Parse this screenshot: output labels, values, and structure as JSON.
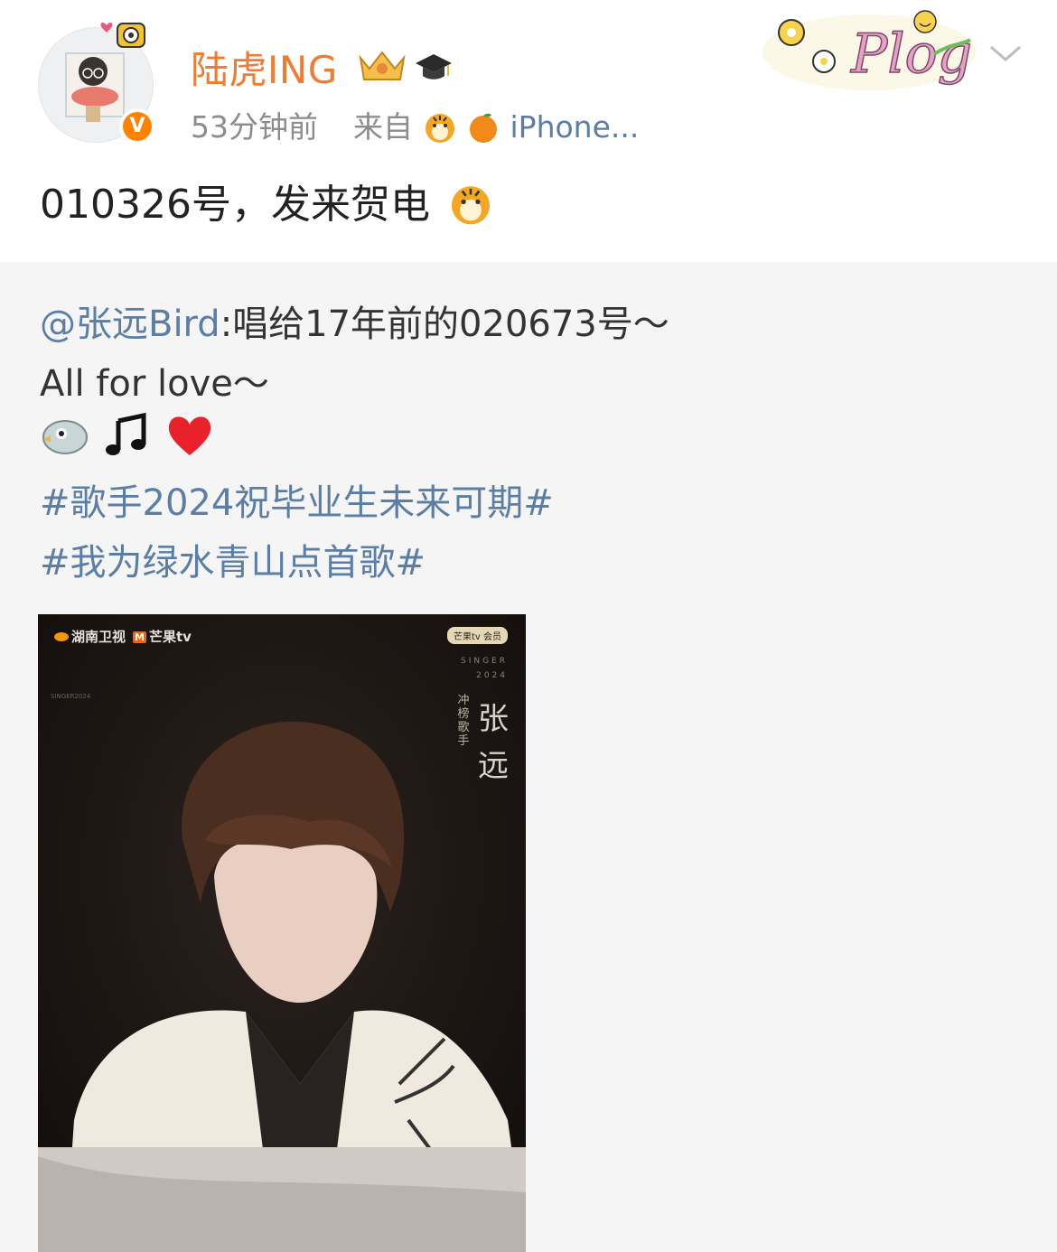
{
  "post": {
    "author": {
      "name": "陆虎ING",
      "badges": [
        "crown-badge",
        "graduation-cap-icon"
      ],
      "verified": true
    },
    "time": "53分钟前",
    "source_prefix": "来自",
    "source": "iPhone...",
    "text": "010326号，发来贺电",
    "header_sticker": "Plog"
  },
  "repost": {
    "mention": "@张远Bird",
    "text_after_mention": ":唱给17年前的020673号～",
    "line2": "All for love～",
    "emojis": [
      "bird-icon",
      "music-note-icon",
      "heart-icon"
    ],
    "topics": [
      "#歌手2024祝毕业生未来可期#",
      "#我为绿水青山点首歌#"
    ],
    "image": {
      "logo_text": "湖南卫视",
      "logo_text2": "芒果tv",
      "vip_badge": "芒果tv 会员",
      "singer_line1": "SINGER",
      "singer_line2": "2024",
      "name": "张远",
      "subtitle": "冲榜歌手",
      "vertical_text": "SINGER2024"
    }
  },
  "colors": {
    "username": "#f07c32",
    "link": "#5b7ea6",
    "meta": "#8c8c8c",
    "repost_bg": "#f5f5f5"
  }
}
